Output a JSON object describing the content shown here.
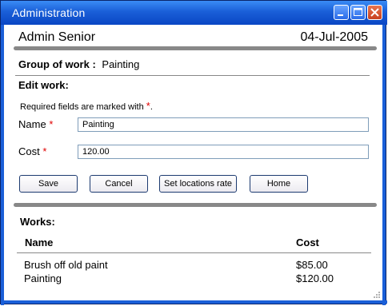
{
  "window": {
    "title": "Administration"
  },
  "header": {
    "user": "Admin Senior",
    "date": "04-Jul-2005"
  },
  "group": {
    "label": "Group of work :",
    "value": "Painting"
  },
  "edit": {
    "heading": "Edit work:",
    "required_note": "Required fields are marked with",
    "required_mark": "*",
    "name_label": "Name",
    "name_value": "Painting",
    "cost_label": "Cost",
    "cost_value": "120.00"
  },
  "buttons": {
    "save": "Save",
    "cancel": "Cancel",
    "set_locations_rate": "Set locations rate",
    "home": "Home"
  },
  "works": {
    "heading": "Works:",
    "columns": [
      "Name",
      "Cost"
    ],
    "rows": [
      {
        "name": "Brush off old paint",
        "cost": "$85.00"
      },
      {
        "name": "Painting",
        "cost": "$120.00"
      }
    ]
  }
}
